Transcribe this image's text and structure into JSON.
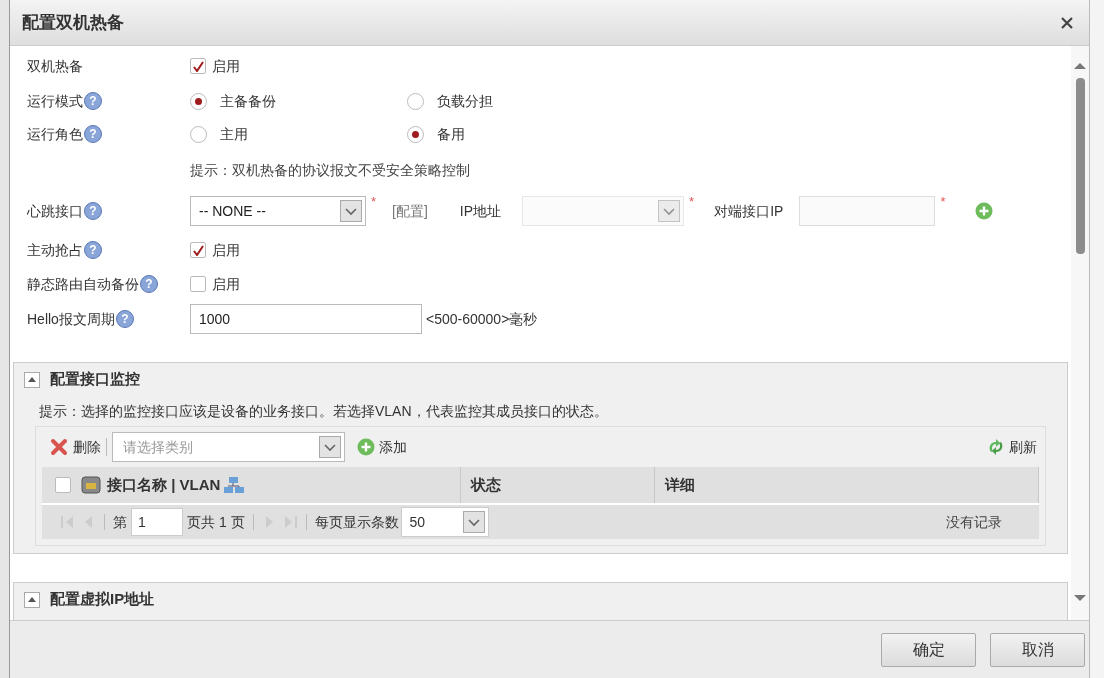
{
  "dialog": {
    "title": "配置双机热备"
  },
  "form": [
    {
      "kind": "checkbox",
      "label": "双机热备",
      "option": "启用",
      "checked": true
    },
    {
      "kind": "radio",
      "label": "运行模式",
      "help": "?",
      "options": [
        {
          "label": "主备备份",
          "selected": true
        },
        {
          "label": "负载分担",
          "selected": false
        }
      ]
    },
    {
      "kind": "radio",
      "label": "运行角色",
      "help": "?",
      "options": [
        {
          "label": "主用",
          "selected": false
        },
        {
          "label": "备用",
          "selected": true
        }
      ]
    },
    {
      "kind": "hint",
      "text": "提示：双机热备的协议报文不受安全策略控制"
    },
    {
      "kind": "heartbeat",
      "label": "心跳接口",
      "help": "?",
      "interface_select": {
        "value": "-- NONE --",
        "required_mark": "*"
      },
      "config_link": "[配置]",
      "ip_label": "IP地址",
      "ip_select": {
        "disabled": true,
        "required_mark": "*"
      },
      "peer_label": "对端接口IP",
      "peer_input": {
        "disabled": true,
        "required_mark": "*"
      }
    },
    {
      "kind": "checkbox",
      "label": "主动抢占",
      "help": "?",
      "option": "启用",
      "checked": true
    },
    {
      "kind": "checkbox",
      "label": "静态路由自动备份",
      "help": "?",
      "option": "启用",
      "checked": false
    },
    {
      "kind": "input",
      "label": "Hello报文周期",
      "help": "?",
      "value": "1000",
      "unit": "<500-60000>毫秒"
    }
  ],
  "sections": [
    {
      "title": "配置接口监控",
      "expanded": true,
      "hint": "提示：选择的监控接口应该是设备的业务接口。若选择VLAN，代表监控其成员接口的状态。",
      "toolbar": {
        "delete": "删除",
        "category_placeholder": "请选择类别",
        "add": "添加",
        "refresh": "刷新"
      },
      "table": {
        "select_all_checked": false,
        "columns": [
          "接口名称 | VLAN",
          "状态",
          "详细"
        ]
      },
      "pager": {
        "page_prefix": "第",
        "page_value": "1",
        "page_suffix": "页共 1 页",
        "page_size_label": "每页显示条数",
        "page_size": "50",
        "empty": "没有记录"
      }
    },
    {
      "title": "配置虚拟IP地址",
      "expanded": true
    }
  ],
  "buttons": [
    "确定",
    "取消"
  ]
}
